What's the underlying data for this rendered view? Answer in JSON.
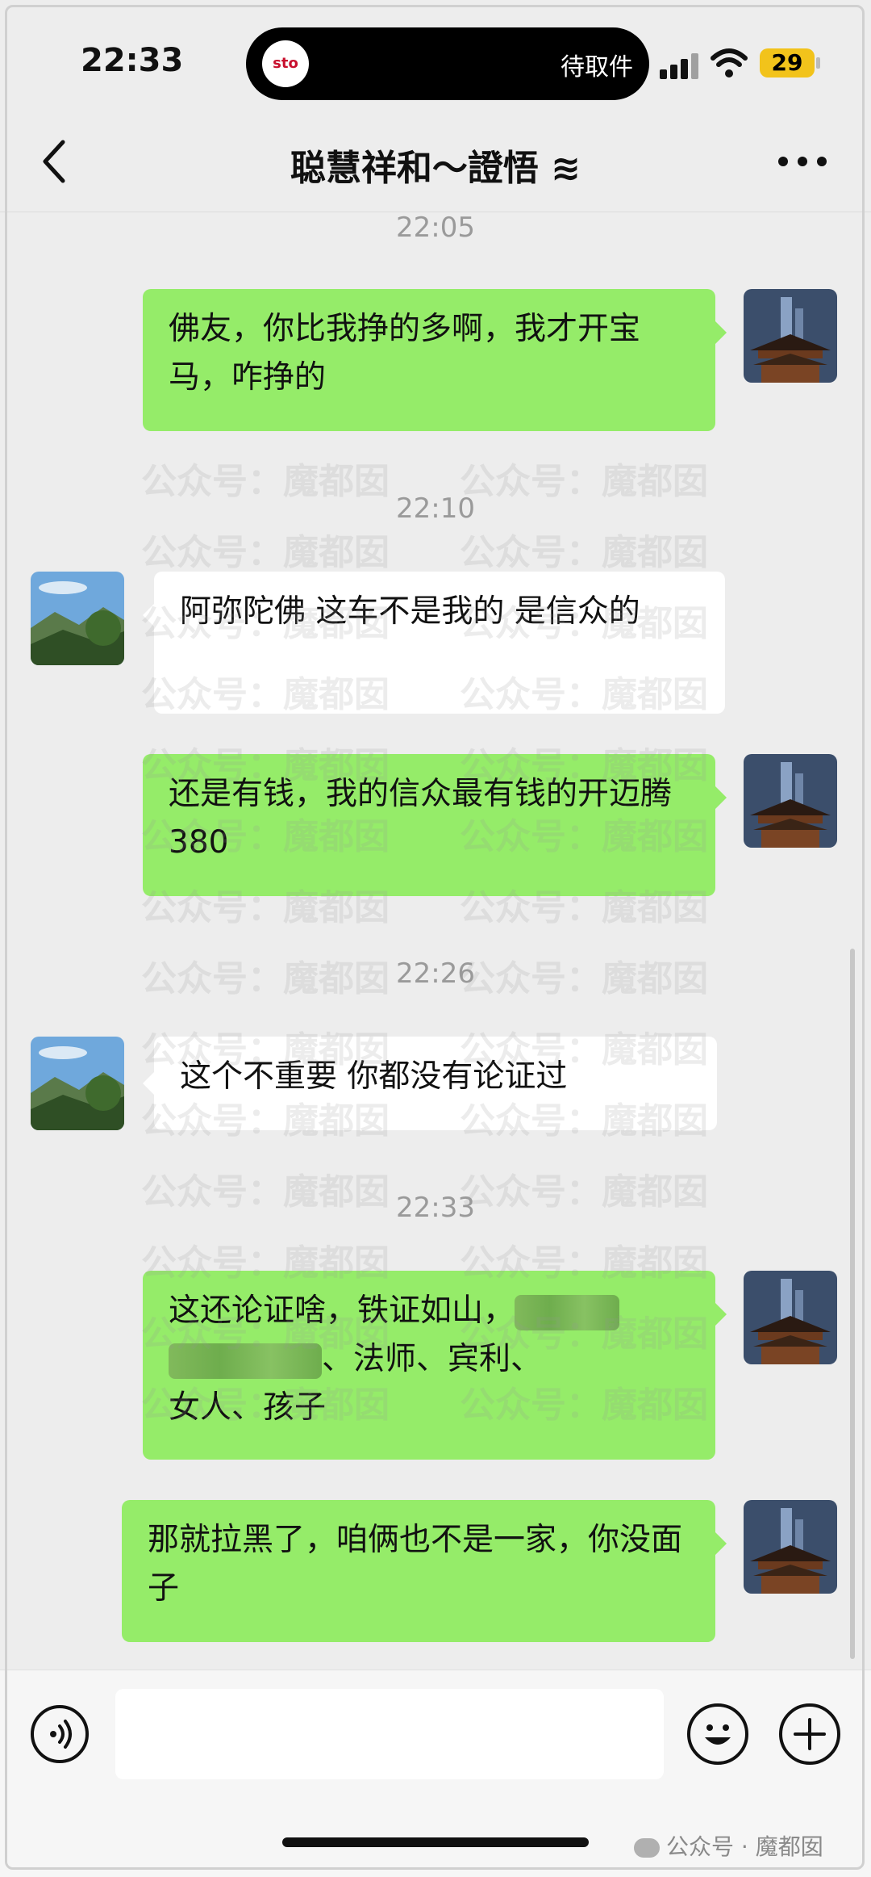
{
  "status_bar": {
    "time": "22:33",
    "live_activity_logo": "sto",
    "live_activity_text": "待取件",
    "battery": "29"
  },
  "nav": {
    "title": "聪慧祥和～證悟 ≋"
  },
  "messages": [
    {
      "timestamp": "22:05"
    },
    {
      "side": "out",
      "text": "佛友，你比我挣的多啊，我才开宝马，咋挣的"
    },
    {
      "timestamp": "22:10"
    },
    {
      "side": "in",
      "text": "阿弥陀佛  这车不是我的  是信众的"
    },
    {
      "side": "out",
      "text": "还是有钱，我的信众最有钱的开迈腾 380"
    },
    {
      "timestamp": "22:26"
    },
    {
      "side": "in",
      "text": "这个不重要   你都没有论证过"
    },
    {
      "timestamp": "22:33"
    },
    {
      "side": "out",
      "text_line1": "这还论证啥，铁证如山，",
      "text_line2": "、法师、宾利、",
      "text_line3": "女人、孩子"
    },
    {
      "side": "out",
      "text": "那就拉黑了，咱俩也不是一家，你没面子"
    }
  ],
  "watermark": {
    "text": "公众号：魔都囡"
  },
  "footer_watermark": {
    "text": "公众号 · 魔都囡"
  },
  "colors": {
    "out_bubble": "#95ec69",
    "in_bubble": "#ffffff",
    "background": "#ededed"
  }
}
